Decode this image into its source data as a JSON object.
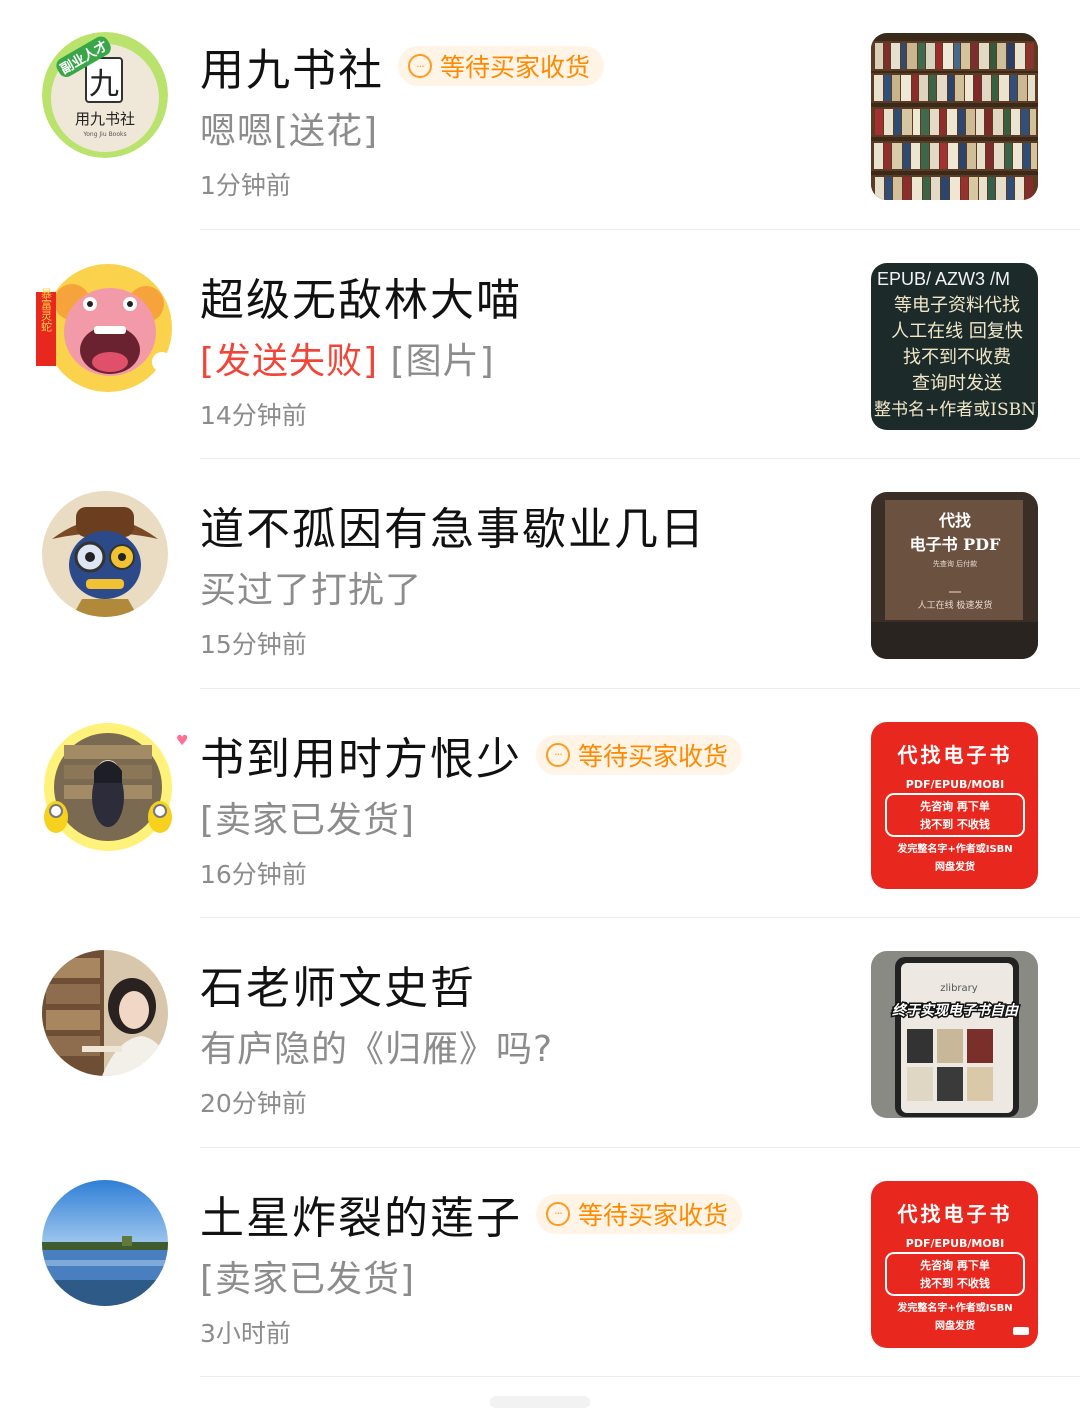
{
  "conversations": [
    {
      "name": "用九书社",
      "status": "等待买家收货",
      "message": "嗯嗯[送花]",
      "time": "1分钟前",
      "avatar_icon": "bookshop-logo-icon",
      "avatar_text": {
        "badge": "副业人才",
        "big": "九",
        "name": "用九书社",
        "sub": "Yong Jiu Books"
      },
      "thumb_icon": "bookshelf-photo"
    },
    {
      "name": "超级无敌林大喵",
      "failed_tag": "[发送失败]",
      "message": "[图片]",
      "time": "14分钟前",
      "avatar_icon": "cartoon-snake-avatar-icon",
      "avatar_text": {
        "banner": "暴富灵蛇"
      },
      "thumb_icon": "ebook-service-card",
      "thumb_text": [
        "/ EPUB/ AZW3 /M",
        "等电子资料代找",
        "人工在线  回复快",
        "找不到不收费",
        "查询时发送",
        "整书名+作者或ISBN"
      ]
    },
    {
      "name": "道不孤因有急事歇业几日",
      "message": "买过了打扰了",
      "time": "15分钟前",
      "avatar_icon": "monocle-character-avatar-icon",
      "thumb_icon": "ebook-pdf-card",
      "thumb_text": [
        "代找",
        "电子书  PDF",
        "先查询 后付款",
        "人工在线  极速发货"
      ]
    },
    {
      "name": "书到用时方恨少",
      "status": "等待买家收货",
      "message": "[卖家已发货]",
      "time": "16分钟前",
      "avatar_icon": "library-girl-minions-avatar-icon",
      "thumb_icon": "red-ebook-card",
      "thumb_text": [
        "代找电子书",
        "PDF/EPUB/MOBI",
        "先咨询   再下单",
        "找不到   不收钱",
        "发完整名字+作者或ISBN",
        "网盘发货"
      ]
    },
    {
      "name": "石老师文史哲",
      "message": "有庐隐的《归雁》吗?",
      "time": "20分钟前",
      "avatar_icon": "reading-woman-avatar-icon",
      "thumb_icon": "tablet-library-photo",
      "thumb_text": [
        "终于实现电子书自由",
        "zlibrary"
      ]
    },
    {
      "name": "土星炸裂的莲子",
      "status": "等待买家收货",
      "message": "[卖家已发货]",
      "time": "3小时前",
      "avatar_icon": "lake-landscape-avatar-icon",
      "thumb_icon": "red-ebook-card",
      "thumb_text": [
        "代找电子书",
        "PDF/EPUB/MOBI",
        "先咨询   再下单",
        "找不到   不收钱",
        "发完整名字+作者或ISBN",
        "网盘发货"
      ]
    }
  ],
  "colors": {
    "status_orange": "#ff8a00",
    "status_bg": "#fff4e6",
    "failed_red": "#f2453a",
    "muted_gray": "#8c8c8c",
    "card_red": "#e8281e"
  }
}
